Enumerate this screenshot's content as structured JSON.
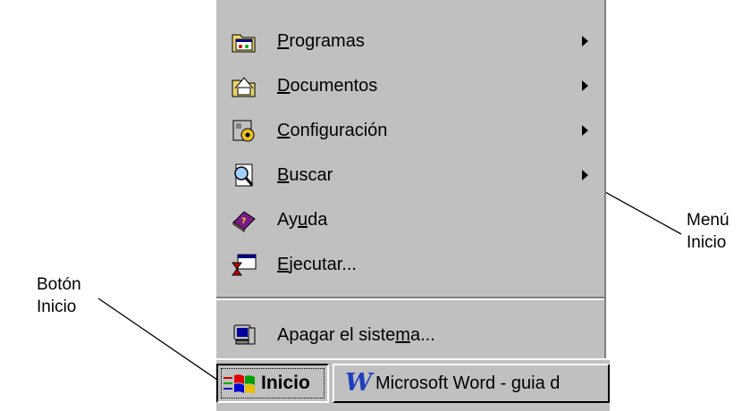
{
  "start_menu": {
    "items": [
      {
        "label": "Programas",
        "mnemonic": "P",
        "icon": "programs-folder-icon",
        "submenu": true
      },
      {
        "label": "Documentos",
        "mnemonic": "D",
        "icon": "documents-folder-icon",
        "submenu": true
      },
      {
        "label": "Configuración",
        "mnemonic": "C",
        "icon": "settings-icon",
        "submenu": true
      },
      {
        "label": "Buscar",
        "mnemonic": "B",
        "icon": "find-magnifier-icon",
        "submenu": true
      },
      {
        "label": "Ayuda",
        "mnemonic": "u",
        "icon": "help-book-icon",
        "submenu": false
      },
      {
        "label": "Ejecutar...",
        "mnemonic": "E",
        "icon": "run-icon",
        "submenu": false
      }
    ],
    "shutdown": {
      "label": "Apagar el sistema...",
      "mnemonic": "m",
      "icon": "shutdown-computer-icon"
    }
  },
  "taskbar": {
    "start_button": {
      "label": "Inicio",
      "icon": "windows-logo-icon"
    },
    "task_button": {
      "label": "Microsoft Word - guia d",
      "icon": "word-icon"
    }
  },
  "annotations": {
    "menu_label": [
      "Menú",
      "Inicio"
    ],
    "button_label": [
      "Botón",
      "Inicio"
    ]
  }
}
